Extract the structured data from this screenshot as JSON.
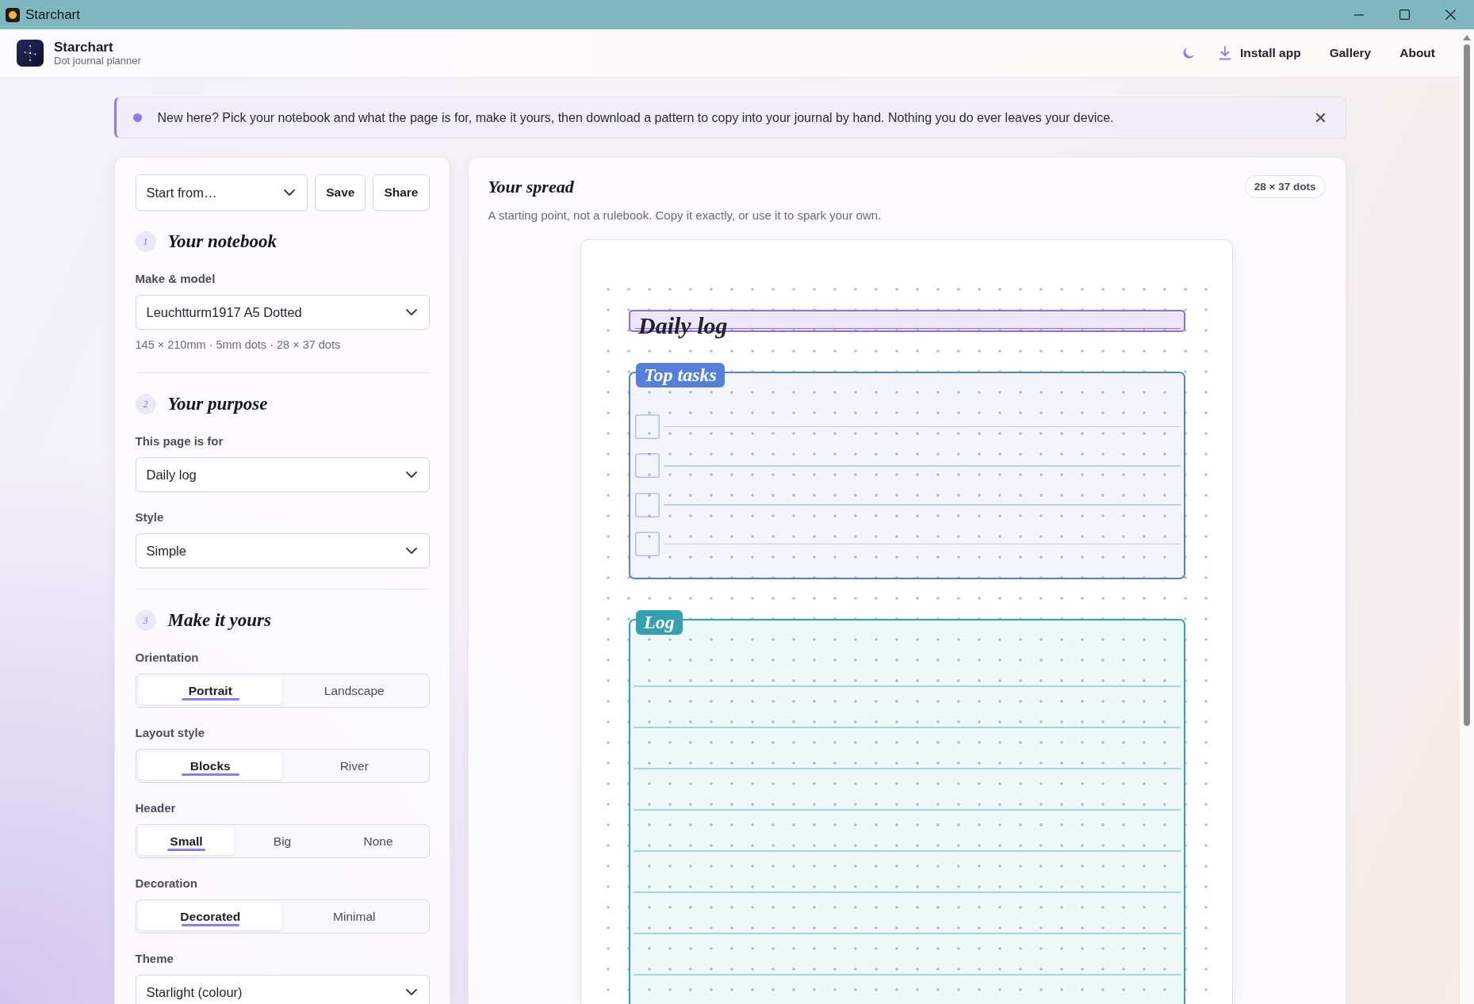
{
  "window": {
    "title": "Starchart"
  },
  "header": {
    "app_name": "Starchart",
    "tagline": "Dot journal planner",
    "actions": [
      {
        "kind": "theme"
      },
      {
        "kind": "install",
        "label": "Install app"
      },
      {
        "kind": "link",
        "label": "Gallery"
      },
      {
        "kind": "link",
        "label": "About"
      }
    ]
  },
  "banner": {
    "text": "New here? Pick your notebook and what the page is for, make it yours, then download a pattern to copy into your journal by hand. Nothing you do ever leaves your device."
  },
  "setup": {
    "preset": {
      "placeholder": "Start from…"
    },
    "buttons": [
      "Save",
      "Share"
    ],
    "sections": [
      {
        "number": "1",
        "title": "Your notebook",
        "fields": [
          {
            "kind": "select",
            "label": "Make & model",
            "value": "Leuchtturm1917 A5 Dotted",
            "hint": "145 × 210mm · 5mm dots · 28 × 37 dots"
          }
        ]
      },
      {
        "number": "2",
        "title": "Your purpose",
        "fields": [
          {
            "kind": "select",
            "label": "This page is for",
            "value": "Daily log"
          },
          {
            "kind": "select",
            "label": "Style",
            "value": "Simple"
          }
        ]
      },
      {
        "number": "3",
        "title": "Make it yours",
        "fields": [
          {
            "kind": "segmented",
            "label": "Orientation",
            "options": [
              {
                "label": "Portrait",
                "selected": true
              },
              {
                "label": "Landscape",
                "selected": false
              }
            ]
          },
          {
            "kind": "segmented",
            "label": "Layout style",
            "options": [
              {
                "label": "Blocks",
                "selected": true
              },
              {
                "label": "River",
                "selected": false
              }
            ]
          },
          {
            "kind": "segmented",
            "label": "Header",
            "options": [
              {
                "label": "Small",
                "selected": true
              },
              {
                "label": "Big",
                "selected": false
              },
              {
                "label": "None",
                "selected": false
              }
            ]
          },
          {
            "kind": "segmented",
            "label": "Decoration",
            "options": [
              {
                "label": "Decorated",
                "selected": true
              },
              {
                "label": "Minimal",
                "selected": false
              }
            ]
          },
          {
            "kind": "select",
            "label": "Theme",
            "value": "Starlight (colour)"
          }
        ]
      }
    ]
  },
  "preview": {
    "title": "Your spread",
    "size": "28 × 37 dots",
    "subtitle": "A starting point, not a rulebook. Copy it exactly, or use it to spark your own.",
    "blocks": [
      {
        "kind": "header",
        "title": "Daily log",
        "color": "#8f6cf2"
      },
      {
        "kind": "tasks",
        "title": "Top tasks",
        "color": "#5480dc",
        "tasks": [
          {
            "checked": false
          },
          {
            "checked": false
          },
          {
            "checked": false
          },
          {
            "checked": false
          }
        ]
      },
      {
        "kind": "lines",
        "title": "Log",
        "color": "#34a0b0"
      }
    ]
  }
}
